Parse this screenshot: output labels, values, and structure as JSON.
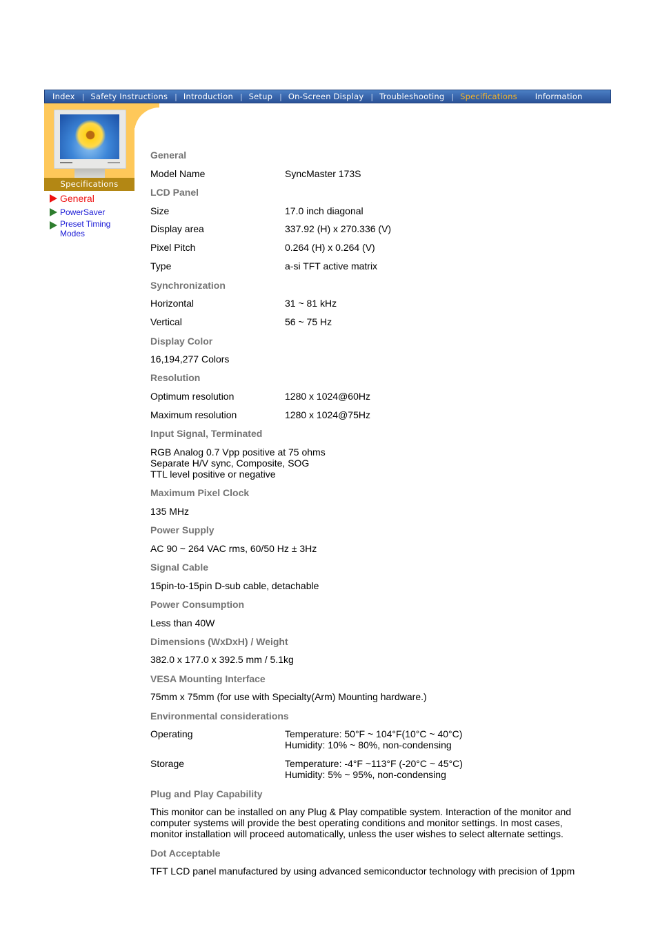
{
  "nav": {
    "items": [
      {
        "label": "Index",
        "active": false
      },
      {
        "label": "Safety Instructions",
        "active": false
      },
      {
        "label": "Introduction",
        "active": false
      },
      {
        "label": "Setup",
        "active": false
      },
      {
        "label": "On-Screen Display",
        "active": false
      },
      {
        "label": "Troubleshooting",
        "active": false
      },
      {
        "label": "Specifications",
        "active": true
      },
      {
        "label": "Information",
        "active": false
      }
    ],
    "separator": "|",
    "active_color": "#f5b52a"
  },
  "sidebar": {
    "image_caption": "Specifications",
    "image_alt": "monitor-with-flower-image",
    "items": [
      {
        "label": "General",
        "active": true
      },
      {
        "label": "PowerSaver",
        "active": false
      },
      {
        "label": "Preset Timing Modes",
        "line1": "Preset Timing",
        "line2": "Modes",
        "active": false
      }
    ]
  },
  "specs": {
    "general": {
      "heading": "General",
      "model_name_label": "Model Name",
      "model_name_value": "SyncMaster 173S"
    },
    "lcd_panel": {
      "heading": "LCD Panel",
      "size_label": "Size",
      "size_value": "17.0 inch diagonal",
      "display_area_label": "Display area",
      "display_area_value": "337.92 (H) x 270.336 (V)",
      "pixel_pitch_label": "Pixel Pitch",
      "pixel_pitch_value": "0.264 (H) x 0.264 (V)",
      "type_label": "Type",
      "type_value": "a-si TFT active matrix"
    },
    "synchronization": {
      "heading": "Synchronization",
      "horizontal_label": "Horizontal",
      "horizontal_value": "31 ~ 81 kHz",
      "vertical_label": "Vertical",
      "vertical_value": "56 ~ 75 Hz"
    },
    "display_color": {
      "heading": "Display Color",
      "value": "16,194,277 Colors"
    },
    "resolution": {
      "heading": "Resolution",
      "optimum_label": "Optimum resolution",
      "optimum_value": "1280 x 1024@60Hz",
      "maximum_label": "Maximum resolution",
      "maximum_value": "1280 x 1024@75Hz"
    },
    "input_signal": {
      "heading": "Input Signal, Terminated",
      "line1": "RGB Analog 0.7 Vpp positive at 75 ohms",
      "line2": "Separate H/V sync, Composite, SOG",
      "line3": "TTL level positive or negative"
    },
    "max_pixel_clock": {
      "heading": "Maximum Pixel Clock",
      "value": "135 MHz"
    },
    "power_supply": {
      "heading": "Power Supply",
      "value": "AC 90 ~ 264 VAC rms, 60/50 Hz ± 3Hz"
    },
    "signal_cable": {
      "heading": "Signal Cable",
      "value": "15pin-to-15pin D-sub cable, detachable"
    },
    "power_consumption": {
      "heading": "Power Consumption",
      "value": "Less than 40W"
    },
    "dimensions": {
      "heading": "Dimensions (WxDxH) / Weight",
      "value": "382.0 x 177.0 x 392.5 mm / 5.1kg"
    },
    "vesa": {
      "heading": "VESA Mounting Interface",
      "value": "75mm x 75mm (for use with Specialty(Arm) Mounting hardware.)"
    },
    "environmental": {
      "heading": "Environmental considerations",
      "operating_label": "Operating",
      "operating_line1": "Temperature: 50°F ~ 104°F(10°C ~ 40°C)",
      "operating_line2": "Humidity: 10% ~ 80%, non-condensing",
      "storage_label": "Storage",
      "storage_line1": "Temperature: -4°F ~113°F (-20°C ~ 45°C)",
      "storage_line2": "Humidity: 5% ~ 95%, non-condensing"
    },
    "plug_and_play": {
      "heading": "Plug and Play Capability",
      "line1": "This monitor can be installed on any Plug & Play compatible system. Interaction of the monitor and",
      "line2": "computer systems will provide the best operating conditions and monitor settings. In most cases,",
      "line3": "monitor installation will proceed automatically, unless the user wishes to select alternate settings."
    },
    "dot_acceptable": {
      "heading": "Dot Acceptable",
      "value": "TFT LCD panel manufactured by using advanced semiconductor technology with precision of 1ppm"
    }
  }
}
